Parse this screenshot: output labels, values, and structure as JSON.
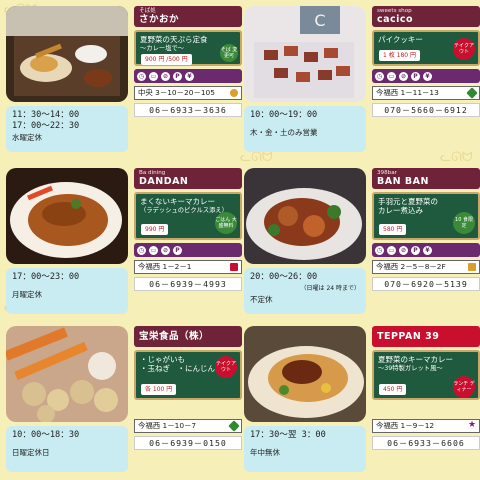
{
  "cards": [
    {
      "category": "そば処",
      "name": "さかおか",
      "menu_line1": "夏野菜の天ぷら定食",
      "menu_line2": "～カレー塩で～",
      "price": "900 円 /500 円",
      "circle_text": "そば 変更可",
      "hours_line1": "11：30～14：00",
      "hours_line2": "17：00～22：30",
      "closed": "水曜定休",
      "address": "中央 3－10－20－105",
      "marker_color": "#d7a12a",
      "tel": "06－6933－3636"
    },
    {
      "category": "sweets shop",
      "name": "cacico",
      "menu_line1": "パイクッキー",
      "menu_line2": "",
      "price": "1 枚 180 円",
      "circle_text": "テイクアウト",
      "hours_line1": "10：00～19：00",
      "hours_line2": "",
      "closed": "木・金・土のみ営業",
      "address": "今福西 1－11－13",
      "marker_color": "#2f8a2f",
      "tel": "070－5660－6912"
    },
    {
      "category": "Ba dining",
      "name": "DANDAN",
      "menu_line1": "まくないキーマカレー",
      "menu_line2": "（ラデッシュのピクルス添え）",
      "price": "990 円",
      "circle_text": "ごはん 大盛無料",
      "hours_line1": "17：00～23：00",
      "hours_line2": "",
      "closed": "月曜定休",
      "address": "今福西 1－2－1",
      "marker_color": "#c8102e",
      "tel": "06－6939－4993"
    },
    {
      "category": "398bar",
      "name": "BAN BAN",
      "menu_line1": "手羽元と夏野菜の",
      "menu_line2": "カレー煮込み",
      "price": "580 円",
      "circle_text": "10 食限定",
      "hours_line1": "20：00～26：00",
      "hours_line2": "（日曜は 24 時まで）",
      "closed": "不定休",
      "address": "今福西 2－5－8－2F",
      "marker_color": "#d7a12a",
      "tel": "070－6920－5139"
    },
    {
      "category": "",
      "name": "宝栄食品（株）",
      "menu_line1": "・じゃがいも",
      "menu_line2": "・玉ねぎ　・にんじん",
      "price": "各 100 円",
      "circle_text": "テイクアウト",
      "hours_line1": "10：00～18：30",
      "hours_line2": "",
      "closed": "日曜定休日",
      "address": "今福西 1－10－7",
      "marker_color": "#2f8a2f",
      "tel": "06－6939－0150"
    },
    {
      "category": "",
      "name": "TEPPAN 39",
      "menu_line1": "夏野菜のキーマカレー",
      "menu_line2": "～39特製ガレット風～",
      "price": "450 円",
      "circle_text": "ランチ ディナー",
      "hours_line1": "17：30～翌 3：00",
      "hours_line2": "",
      "closed": "年中無休",
      "address": "今福西 1－9－12",
      "marker_color": "#7a1f7a",
      "tel": "06－6933－6606"
    }
  ]
}
